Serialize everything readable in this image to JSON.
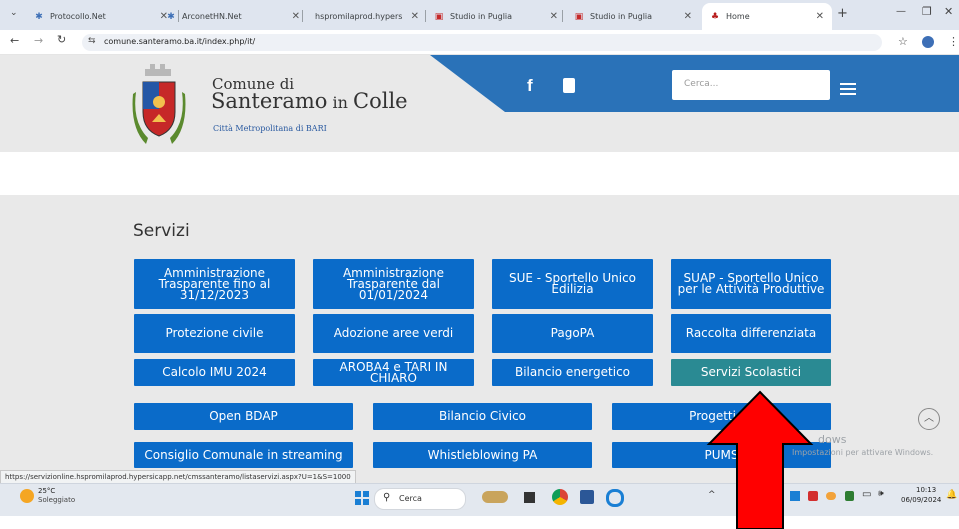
{
  "tabs": [
    {
      "title": "Protocollo.Net",
      "icon": "app-icon"
    },
    {
      "title": "ArconetHN.Net",
      "icon": "app-icon"
    },
    {
      "title": "hspromilaprod.hypersicap…",
      "icon": "none"
    },
    {
      "title": "Studio in Puglia",
      "icon": "studio-icon"
    },
    {
      "title": "Studio in Puglia",
      "icon": "studio-icon"
    },
    {
      "title": "Home",
      "icon": "comune-icon"
    }
  ],
  "address": {
    "url": "comune.santeramo.ba.it/index.php/it/"
  },
  "site": {
    "line1": "Comune di",
    "line2_main": "Santeramo",
    "line2_in": " in ",
    "line2_end": "Colle",
    "subtitle": "Città Metropolitana di BARI",
    "search_placeholder": "Cerca..."
  },
  "services": {
    "heading": "Servizi",
    "rows": [
      [
        "Amministrazione Trasparente fino al 31/12/2023",
        "Amministrazione Trasparente dal 01/01/2024",
        "SUE - Sportello Unico Edilizia",
        "SUAP - Sportello Unico per le Attività Produttive"
      ],
      [
        "Protezione civile",
        "Adozione aree verdi",
        "PagoPA",
        "Raccolta differenziata"
      ],
      [
        "Calcolo IMU 2024",
        "AROBA4 e TARI IN CHIARO",
        "Bilancio energetico",
        "Servizi Scolastici"
      ],
      [
        "Open BDAP",
        "Bilancio Civico",
        "Progetti Pa"
      ],
      [
        "Consiglio Comunale in streaming",
        "Whistleblowing PA",
        "PUMS"
      ]
    ],
    "highlight_color": "#2a8a93",
    "button_color": "#0a6bc9"
  },
  "status_url": "https://servizionline.hspromilaprod.hypersicapp.net/cmssanteramo/listaservizi.aspx?U=1&S=1000",
  "watermark": {
    "line1": "dows",
    "line2": "Impostazioni per attivare Windows."
  },
  "taskbar": {
    "weather_temp": "25°C",
    "weather_desc": "Soleggiato",
    "search_label": "Cerca",
    "time": "10:13",
    "date": "06/09/2024"
  },
  "annotation": {
    "arrow_color": "#ff0000"
  }
}
